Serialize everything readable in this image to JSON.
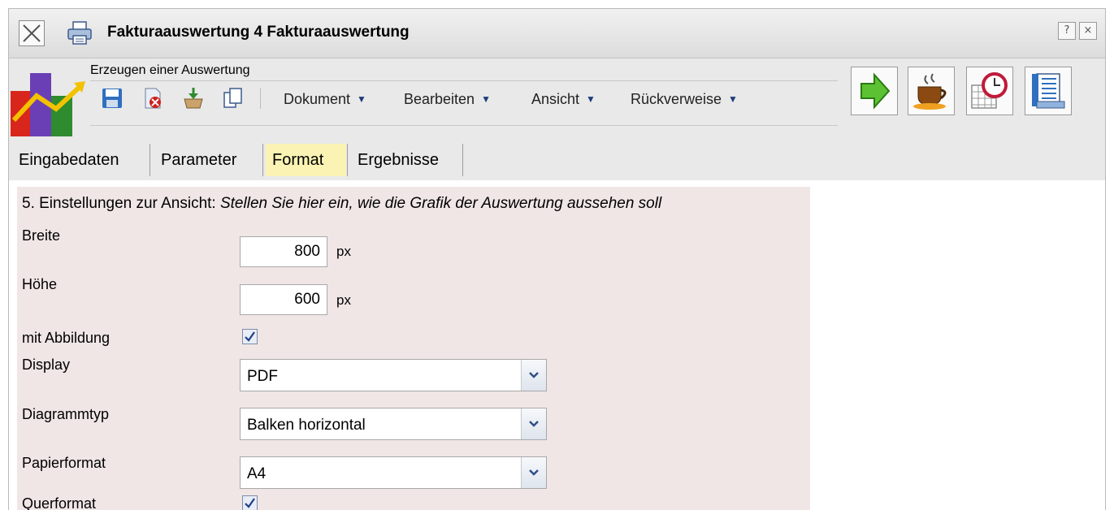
{
  "window": {
    "title": "Fakturaauswertung 4 Fakturaauswertung",
    "help_label": "?",
    "close_label": "×"
  },
  "toolbar": {
    "subtitle": "Erzeugen einer Auswertung",
    "menus": [
      "Dokument",
      "Bearbeiten",
      "Ansicht",
      "Rückverweise"
    ],
    "caret": "▼"
  },
  "tabs": [
    "Eingabedaten",
    "Parameter",
    "Format",
    "Ergebnisse"
  ],
  "active_tab": "Format",
  "form": {
    "heading_prefix": "5. Einstellungen zur Ansicht: ",
    "heading_italic": "Stellen Sie hier ein, wie die Grafik der Auswertung aussehen soll",
    "breite_label": "Breite",
    "breite_value": "800",
    "hoehe_label": "Höhe",
    "hoehe_value": "600",
    "unit": "px",
    "mit_abbildung_label": "mit Abbildung",
    "mit_abbildung_checked": true,
    "display_label": "Display",
    "display_value": "PDF",
    "diagrammtyp_label": "Diagrammtyp",
    "diagrammtyp_value": "Balken horizontal",
    "papierformat_label": "Papierformat",
    "papierformat_value": "A4",
    "querformat_label": "Querformat",
    "querformat_checked": true
  },
  "colors": {
    "panel_bg": "#f0e6e6",
    "active_tab_bg": "#fbf3b3",
    "toolbar_bg": "#e9e9e9"
  }
}
